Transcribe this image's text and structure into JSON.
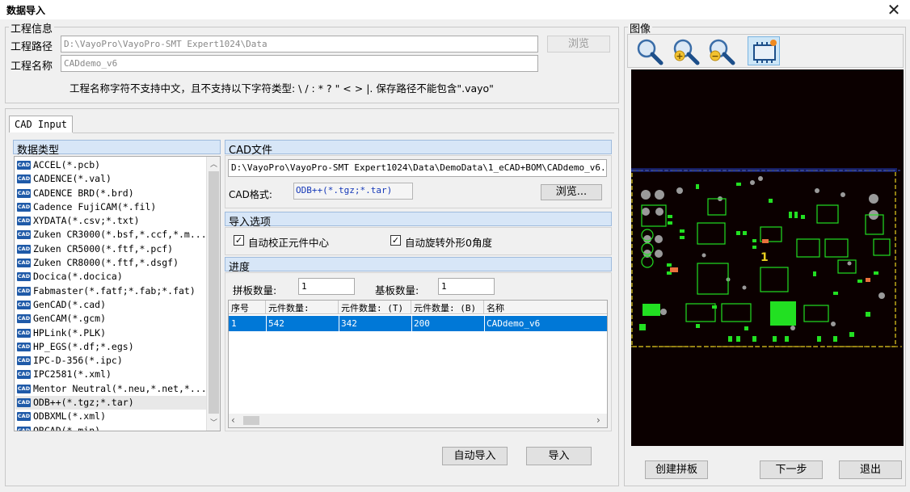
{
  "window": {
    "title": "数据导入",
    "close_icon": "close-icon"
  },
  "project_info": {
    "legend": "工程信息",
    "path_label": "工程路径",
    "path_value": "D:\\VayoPro\\VayoPro-SMT Expert1024\\Data",
    "browse_label": "浏览",
    "name_label": "工程名称",
    "name_value": "CADdemo_v6",
    "hint": "工程名称字符不支持中文，且不支持以下字符类型: \\ / : * ? \" < > |.  保存路径不能包含\".vayo\""
  },
  "tabs": [
    "CAD Input"
  ],
  "data_type": {
    "header": "数据类型",
    "items": [
      "ACCEL(*.pcb)",
      "CADENCE(*.val)",
      "CADENCE BRD(*.brd)",
      "Cadence FujiCAM(*.fil)",
      "XYDATA(*.csv;*.txt)",
      "Zuken CR3000(*.bsf,*.ccf,*.m...",
      "Zuken CR5000(*.ftf,*.pcf)",
      "Zuken CR8000(*.ftf,*.dsgf)",
      "Docica(*.docica)",
      "Fabmaster(*.fatf;*.fab;*.fat)",
      "GenCAD(*.cad)",
      "GenCAM(*.gcm)",
      "HPLink(*.PLK)",
      "HP_EGS(*.df;*.egs)",
      "IPC-D-356(*.ipc)",
      "IPC2581(*.xml)",
      "Mentor Neutral(*.neu,*.net,*...",
      "ODB++(*.tgz;*.tar)",
      "ODBXML(*.xml)",
      "ORCAD(*.min)"
    ],
    "selected_index": 17,
    "icon_text": "CAD"
  },
  "cad_file": {
    "header": "CAD文件",
    "path": "D:\\VayoPro\\VayoPro-SMT Expert1024\\Data\\DemoData\\1_eCAD+BOM\\CADdemo_v6.",
    "format_label": "CAD格式:",
    "format_value": "ODB++(*.tgz;*.tar)",
    "browse_label": "浏览..."
  },
  "import_options": {
    "header": "导入选项",
    "auto_center_label": "自动校正元件中心",
    "auto_center_checked": true,
    "auto_rotate_label": "自动旋转外形0角度",
    "auto_rotate_checked": true
  },
  "progress": {
    "header": "进度",
    "panel_count_label": "拼板数量:",
    "panel_count_value": "1",
    "substrate_count_label": "基板数量:",
    "substrate_count_value": "1",
    "columns": [
      "序号",
      "元件数量:",
      "元件数量: (T)",
      "元件数量: (B)",
      "名称"
    ],
    "rows": [
      [
        "1",
        "542",
        "342",
        "200",
        "CADdemo_v6"
      ]
    ]
  },
  "buttons": {
    "auto_import": "自动导入",
    "import": "导入",
    "create_panel": "创建拼板",
    "next": "下一步",
    "exit": "退出"
  },
  "image_panel": {
    "legend": "图像",
    "toolbar": [
      "zoom-icon",
      "zoom-in-icon",
      "zoom-out-icon",
      "board-view-icon"
    ],
    "pcb_label": "1",
    "colors": {
      "background": "#0b0000",
      "copper": "#22e022",
      "pads": "#9a9a9a",
      "outline": "#e8d020",
      "selected": "#e8713c"
    }
  }
}
